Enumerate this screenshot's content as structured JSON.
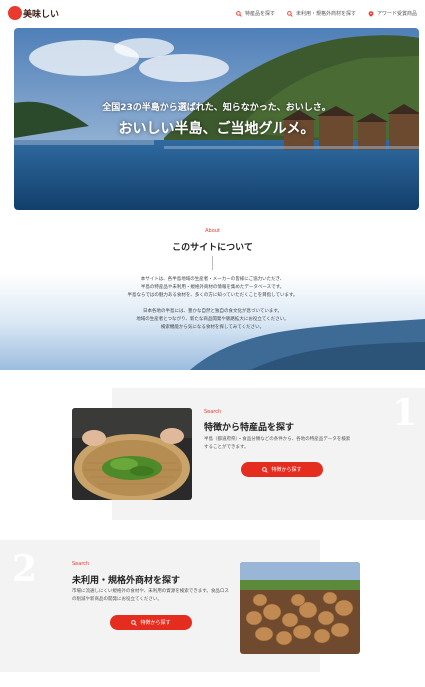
{
  "header": {
    "logo_text": "美味しい",
    "nav": [
      {
        "label": "特産品を探す",
        "icon": "search-icon"
      },
      {
        "label": "未利用・規格外商材を探す",
        "icon": "search-icon"
      },
      {
        "label": "アワード受賞商品",
        "icon": "pin-icon"
      }
    ]
  },
  "hero": {
    "subtitle": "全国23の半島から選ばれた、知らなかった、おいしさ。",
    "title": "おいしい半島、ご当地グルメ。"
  },
  "about": {
    "eyebrow": "About",
    "title": "このサイトについて",
    "paragraph1": [
      "本サイトは、各半島地域の生産者・メーカーの皆様にご協力いただき、",
      "半島の特産品や未利用・規格外商材の情報を集めたデータベースです。",
      "半島ならではの魅力ある食材を、多くの方に知っていただくことを目指しています。"
    ],
    "paragraph2": [
      "日本各地の半島には、豊かな自然と独自の食文化が息づいています。",
      "地域の生産者とつながり、新たな商品開発や販路拡大にお役立てください。",
      "検索機能から気になる食材を探してみてください。"
    ]
  },
  "section1": {
    "number": "1",
    "eyebrow": "Search",
    "title": "特徴から特産品を探す",
    "desc": "半島（都道府県）・食品分類などの条件から、各地の特産品データを検索することができます。",
    "button": "特徴から探す"
  },
  "section2": {
    "number": "2",
    "eyebrow": "Search",
    "title": "未利用・規格外商材を探す",
    "desc": "市場に流通しにくい規格外の食材や、未利用の資源を検索できます。食品ロスの削減や新商品の開発にお役立てください。",
    "button": "特徴から探す"
  },
  "colors": {
    "accent": "#e52d1f"
  }
}
